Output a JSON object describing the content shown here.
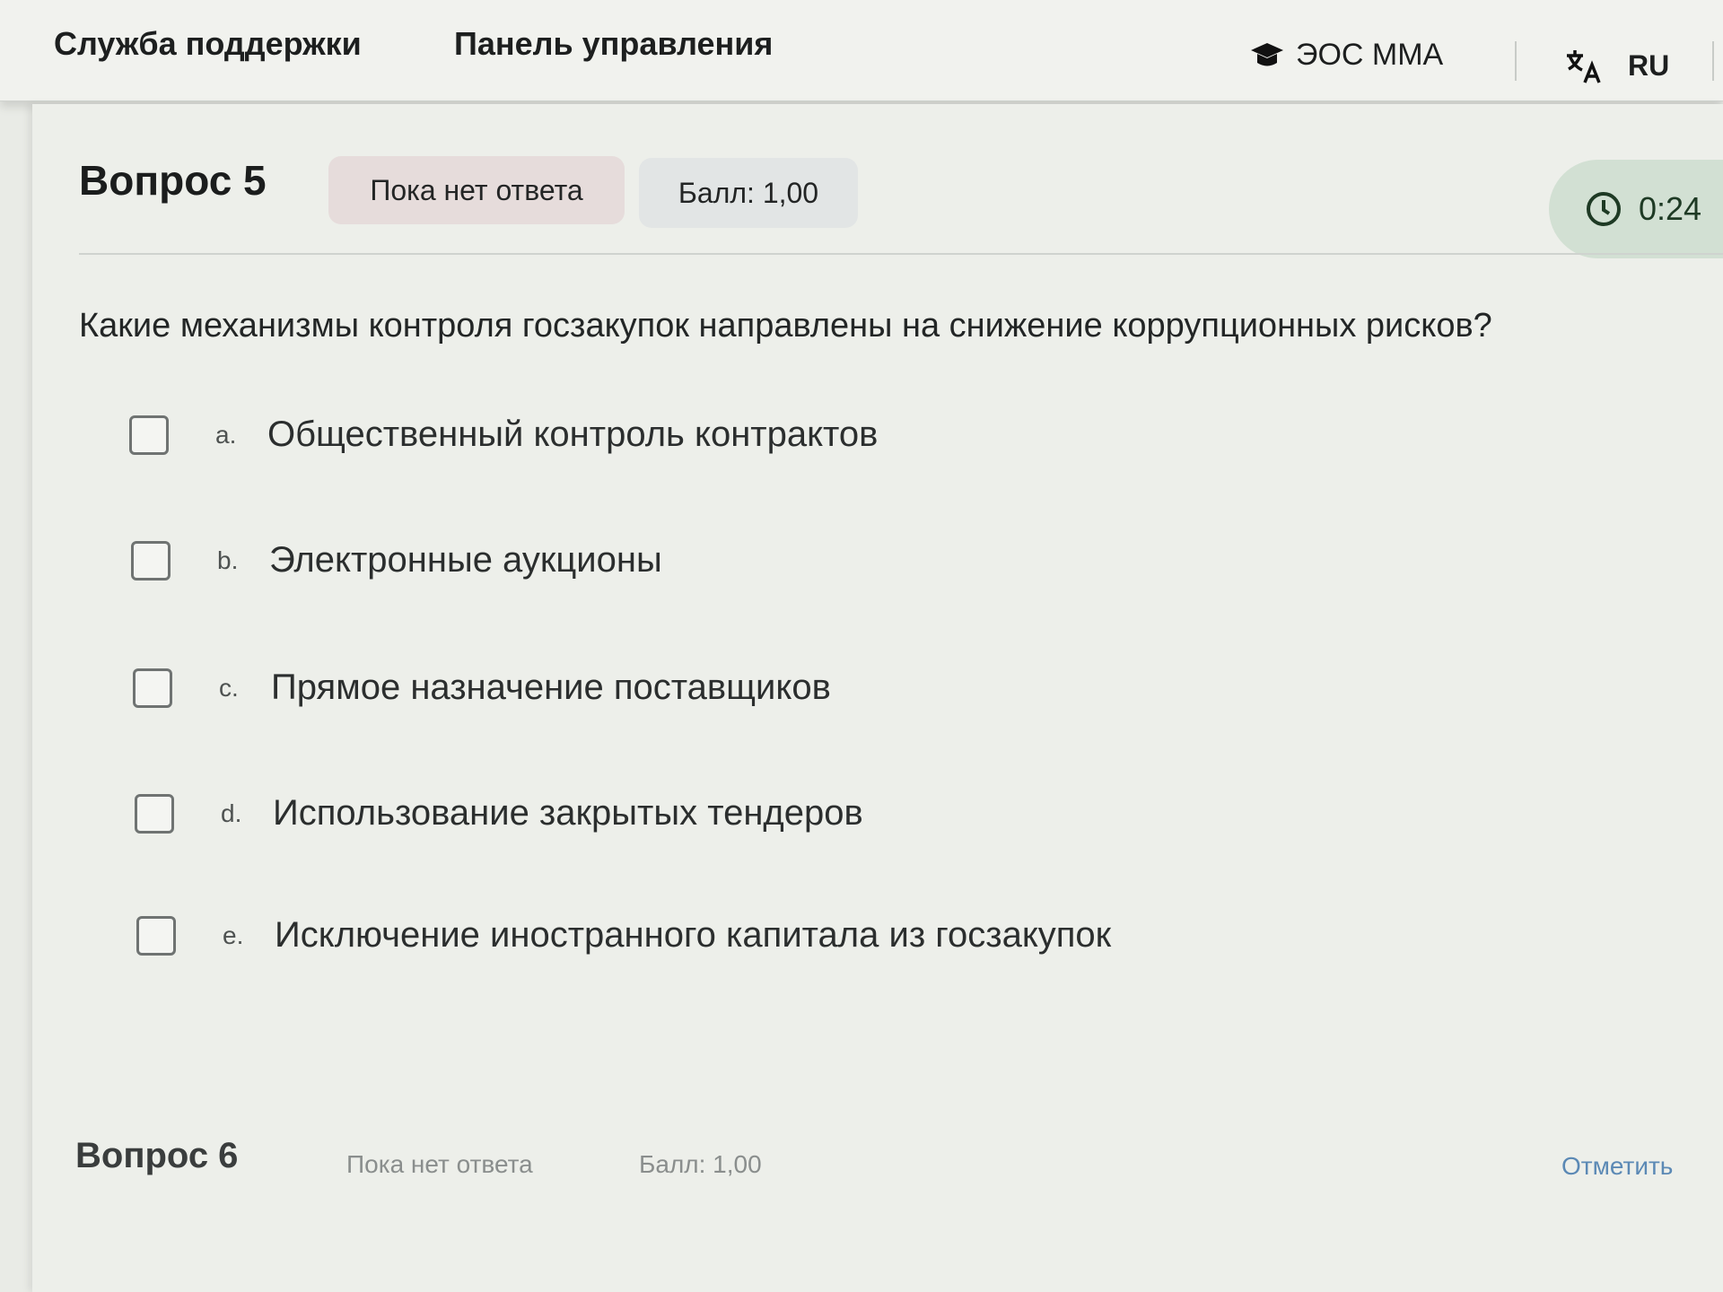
{
  "topbar": {
    "support_label": "Служба поддержки",
    "dashboard_label": "Панель управления",
    "site_label": "ЭОС ММА",
    "language_label": "RU"
  },
  "question": {
    "title": "Вопрос 5",
    "status": "Пока нет ответа",
    "score": "Балл: 1,00",
    "timer": "0:24",
    "text": "Какие механизмы контроля госзакупок направлены на снижение коррупционных рисков?",
    "options": [
      {
        "letter": "a.",
        "text": "Общественный контроль контрактов"
      },
      {
        "letter": "b.",
        "text": "Электронные аукционы"
      },
      {
        "letter": "c.",
        "text": "Прямое назначение поставщиков"
      },
      {
        "letter": "d.",
        "text": "Использование закрытых тендеров"
      },
      {
        "letter": "e.",
        "text": "Исключение иностранного капитала из госзакупок"
      }
    ]
  },
  "next_question": {
    "title": "Вопрос 6",
    "status": "Пока нет ответа",
    "score": "Балл: 1,00",
    "flag_label": "Отметить"
  },
  "icons": {
    "site": "graduation-cap-icon",
    "language": "translate-icon",
    "timer": "clock-icon"
  },
  "colors": {
    "status_badge_bg": "#e6dcdb",
    "score_badge_bg": "#e2e5e5",
    "timer_bg": "#d2e0d3",
    "link": "#5b89b5"
  }
}
